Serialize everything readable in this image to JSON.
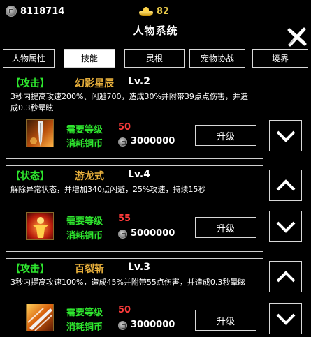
{
  "header": {
    "coins": "8118714",
    "ingots": "82",
    "title": "人物系统"
  },
  "tabs": [
    {
      "label": "人物属性",
      "active": false
    },
    {
      "label": "技能",
      "active": true
    },
    {
      "label": "灵根",
      "active": false
    },
    {
      "label": "宠物协战",
      "active": false
    },
    {
      "label": "境界",
      "active": false
    }
  ],
  "skills": [
    {
      "tag": "【攻击】",
      "name": "幻影星辰",
      "level": "Lv.2",
      "desc": "3秒内提高攻速200%、闪避700，造成30%并附带39点点伤害，并造成0.3秒晕眩",
      "req_label": "需要等级",
      "req_value": "50",
      "cost_label": "消耗铜币",
      "cost_value": "3000000",
      "upgrade_label": "升级",
      "icon": "sword-strike-icon"
    },
    {
      "tag": "【状态】",
      "name": "游龙式",
      "level": "Lv.4",
      "desc": "解除异常状态，并增加340点闪避，25%攻速，持续15秒",
      "req_label": "需要等级",
      "req_value": "55",
      "cost_label": "消耗铜币",
      "cost_value": "5000000",
      "upgrade_label": "升级",
      "icon": "aura-figure-icon"
    },
    {
      "tag": "【攻击】",
      "name": "百裂斩",
      "level": "Lv.3",
      "desc": "3秒内提高攻速100%，造成45%并附带55点伤害，并造成0.3秒晕眩",
      "req_label": "需要等级",
      "req_value": "50",
      "cost_label": "消耗铜币",
      "cost_value": "3000000",
      "upgrade_label": "升级",
      "icon": "blade-slash-icon"
    }
  ],
  "colors": {
    "tag_green": "#2ee62e",
    "name_gold": "#e8b03c",
    "req_red": "#ff3b3b"
  }
}
